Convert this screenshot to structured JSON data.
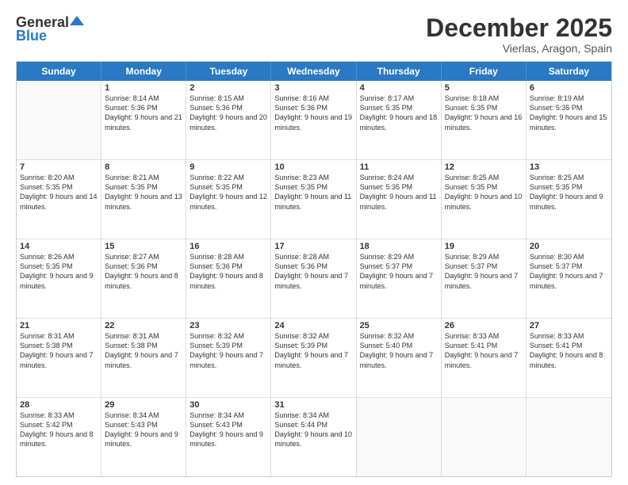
{
  "header": {
    "logo_general": "General",
    "logo_blue": "Blue",
    "month_title": "December 2025",
    "location": "Vierlas, Aragon, Spain"
  },
  "days_of_week": [
    "Sunday",
    "Monday",
    "Tuesday",
    "Wednesday",
    "Thursday",
    "Friday",
    "Saturday"
  ],
  "weeks": [
    [
      {
        "day": "",
        "sunrise": "",
        "sunset": "",
        "daylight": ""
      },
      {
        "day": "1",
        "sunrise": "Sunrise: 8:14 AM",
        "sunset": "Sunset: 5:36 PM",
        "daylight": "Daylight: 9 hours and 21 minutes."
      },
      {
        "day": "2",
        "sunrise": "Sunrise: 8:15 AM",
        "sunset": "Sunset: 5:36 PM",
        "daylight": "Daylight: 9 hours and 20 minutes."
      },
      {
        "day": "3",
        "sunrise": "Sunrise: 8:16 AM",
        "sunset": "Sunset: 5:36 PM",
        "daylight": "Daylight: 9 hours and 19 minutes."
      },
      {
        "day": "4",
        "sunrise": "Sunrise: 8:17 AM",
        "sunset": "Sunset: 5:35 PM",
        "daylight": "Daylight: 9 hours and 18 minutes."
      },
      {
        "day": "5",
        "sunrise": "Sunrise: 8:18 AM",
        "sunset": "Sunset: 5:35 PM",
        "daylight": "Daylight: 9 hours and 16 minutes."
      },
      {
        "day": "6",
        "sunrise": "Sunrise: 8:19 AM",
        "sunset": "Sunset: 5:35 PM",
        "daylight": "Daylight: 9 hours and 15 minutes."
      }
    ],
    [
      {
        "day": "7",
        "sunrise": "Sunrise: 8:20 AM",
        "sunset": "Sunset: 5:35 PM",
        "daylight": "Daylight: 9 hours and 14 minutes."
      },
      {
        "day": "8",
        "sunrise": "Sunrise: 8:21 AM",
        "sunset": "Sunset: 5:35 PM",
        "daylight": "Daylight: 9 hours and 13 minutes."
      },
      {
        "day": "9",
        "sunrise": "Sunrise: 8:22 AM",
        "sunset": "Sunset: 5:35 PM",
        "daylight": "Daylight: 9 hours and 12 minutes."
      },
      {
        "day": "10",
        "sunrise": "Sunrise: 8:23 AM",
        "sunset": "Sunset: 5:35 PM",
        "daylight": "Daylight: 9 hours and 11 minutes."
      },
      {
        "day": "11",
        "sunrise": "Sunrise: 8:24 AM",
        "sunset": "Sunset: 5:35 PM",
        "daylight": "Daylight: 9 hours and 11 minutes."
      },
      {
        "day": "12",
        "sunrise": "Sunrise: 8:25 AM",
        "sunset": "Sunset: 5:35 PM",
        "daylight": "Daylight: 9 hours and 10 minutes."
      },
      {
        "day": "13",
        "sunrise": "Sunrise: 8:25 AM",
        "sunset": "Sunset: 5:35 PM",
        "daylight": "Daylight: 9 hours and 9 minutes."
      }
    ],
    [
      {
        "day": "14",
        "sunrise": "Sunrise: 8:26 AM",
        "sunset": "Sunset: 5:35 PM",
        "daylight": "Daylight: 9 hours and 9 minutes."
      },
      {
        "day": "15",
        "sunrise": "Sunrise: 8:27 AM",
        "sunset": "Sunset: 5:36 PM",
        "daylight": "Daylight: 9 hours and 8 minutes."
      },
      {
        "day": "16",
        "sunrise": "Sunrise: 8:28 AM",
        "sunset": "Sunset: 5:36 PM",
        "daylight": "Daylight: 9 hours and 8 minutes."
      },
      {
        "day": "17",
        "sunrise": "Sunrise: 8:28 AM",
        "sunset": "Sunset: 5:36 PM",
        "daylight": "Daylight: 9 hours and 7 minutes."
      },
      {
        "day": "18",
        "sunrise": "Sunrise: 8:29 AM",
        "sunset": "Sunset: 5:37 PM",
        "daylight": "Daylight: 9 hours and 7 minutes."
      },
      {
        "day": "19",
        "sunrise": "Sunrise: 8:29 AM",
        "sunset": "Sunset: 5:37 PM",
        "daylight": "Daylight: 9 hours and 7 minutes."
      },
      {
        "day": "20",
        "sunrise": "Sunrise: 8:30 AM",
        "sunset": "Sunset: 5:37 PM",
        "daylight": "Daylight: 9 hours and 7 minutes."
      }
    ],
    [
      {
        "day": "21",
        "sunrise": "Sunrise: 8:31 AM",
        "sunset": "Sunset: 5:38 PM",
        "daylight": "Daylight: 9 hours and 7 minutes."
      },
      {
        "day": "22",
        "sunrise": "Sunrise: 8:31 AM",
        "sunset": "Sunset: 5:38 PM",
        "daylight": "Daylight: 9 hours and 7 minutes."
      },
      {
        "day": "23",
        "sunrise": "Sunrise: 8:32 AM",
        "sunset": "Sunset: 5:39 PM",
        "daylight": "Daylight: 9 hours and 7 minutes."
      },
      {
        "day": "24",
        "sunrise": "Sunrise: 8:32 AM",
        "sunset": "Sunset: 5:39 PM",
        "daylight": "Daylight: 9 hours and 7 minutes."
      },
      {
        "day": "25",
        "sunrise": "Sunrise: 8:32 AM",
        "sunset": "Sunset: 5:40 PM",
        "daylight": "Daylight: 9 hours and 7 minutes."
      },
      {
        "day": "26",
        "sunrise": "Sunrise: 8:33 AM",
        "sunset": "Sunset: 5:41 PM",
        "daylight": "Daylight: 9 hours and 7 minutes."
      },
      {
        "day": "27",
        "sunrise": "Sunrise: 8:33 AM",
        "sunset": "Sunset: 5:41 PM",
        "daylight": "Daylight: 9 hours and 8 minutes."
      }
    ],
    [
      {
        "day": "28",
        "sunrise": "Sunrise: 8:33 AM",
        "sunset": "Sunset: 5:42 PM",
        "daylight": "Daylight: 9 hours and 8 minutes."
      },
      {
        "day": "29",
        "sunrise": "Sunrise: 8:34 AM",
        "sunset": "Sunset: 5:43 PM",
        "daylight": "Daylight: 9 hours and 9 minutes."
      },
      {
        "day": "30",
        "sunrise": "Sunrise: 8:34 AM",
        "sunset": "Sunset: 5:43 PM",
        "daylight": "Daylight: 9 hours and 9 minutes."
      },
      {
        "day": "31",
        "sunrise": "Sunrise: 8:34 AM",
        "sunset": "Sunset: 5:44 PM",
        "daylight": "Daylight: 9 hours and 10 minutes."
      },
      {
        "day": "",
        "sunrise": "",
        "sunset": "",
        "daylight": ""
      },
      {
        "day": "",
        "sunrise": "",
        "sunset": "",
        "daylight": ""
      },
      {
        "day": "",
        "sunrise": "",
        "sunset": "",
        "daylight": ""
      }
    ]
  ]
}
